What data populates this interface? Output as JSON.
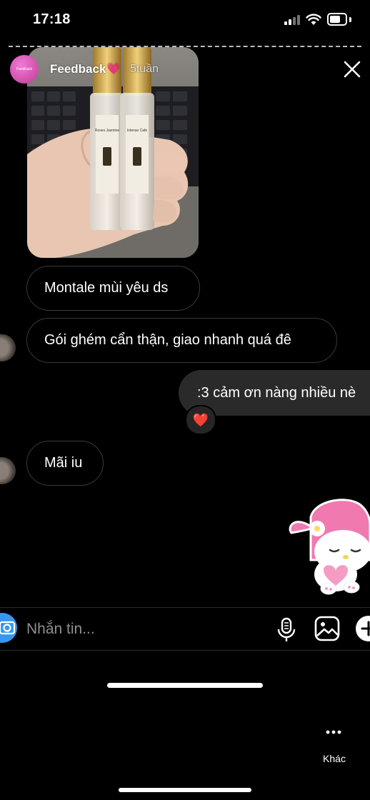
{
  "status_bar": {
    "time": "17:18"
  },
  "story": {
    "title": "Feedback",
    "title_emoji": "💗",
    "age": "5tuần",
    "avatar_text": "Feedback",
    "photo_label_1": "Roses Jasmine",
    "photo_label_2": "Intense Cafe"
  },
  "messages": [
    {
      "direction": "incoming",
      "text": "Montale mùi yêu ds"
    },
    {
      "direction": "incoming",
      "text": "Gói ghém cẩn thận, giao nhanh quá đê"
    },
    {
      "direction": "outgoing",
      "text": ":3 cảm ơn nàng nhiều nè",
      "reaction": "❤️"
    },
    {
      "direction": "incoming",
      "text": "Mãi iu"
    }
  ],
  "sticker": {
    "name": "my-melody-sticker"
  },
  "composer": {
    "placeholder": "Nhắn tin..."
  },
  "footer": {
    "more_label": "Khác"
  },
  "icons": [
    "close-icon",
    "camera-icon",
    "microphone-icon",
    "gallery-icon",
    "plus-icon",
    "more-icon",
    "heart-icon"
  ]
}
